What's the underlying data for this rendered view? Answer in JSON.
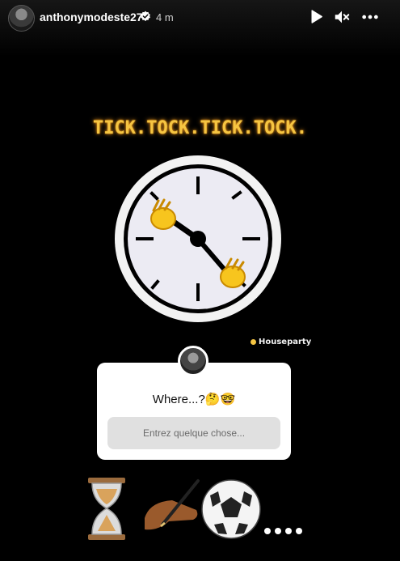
{
  "header": {
    "username": "anthonymodeste27",
    "time_ago": "4 m",
    "verified": true,
    "controls": [
      "play-icon",
      "mute-icon",
      "more-icon"
    ]
  },
  "story": {
    "title": "TICK.TOCK.TICK.TOCK.",
    "brand": "Houseparty"
  },
  "question_sticker": {
    "question": "Where...?🤔🤓",
    "placeholder": "Entrez quelque chose..."
  },
  "emoji_row": [
    "hourglass-icon",
    "writing-hand-icon",
    "soccer-ball-icon",
    "dots"
  ],
  "colors": {
    "background": "#000000",
    "title": "#f5c542",
    "card": "#ffffff",
    "input": "#e0e0e0"
  }
}
